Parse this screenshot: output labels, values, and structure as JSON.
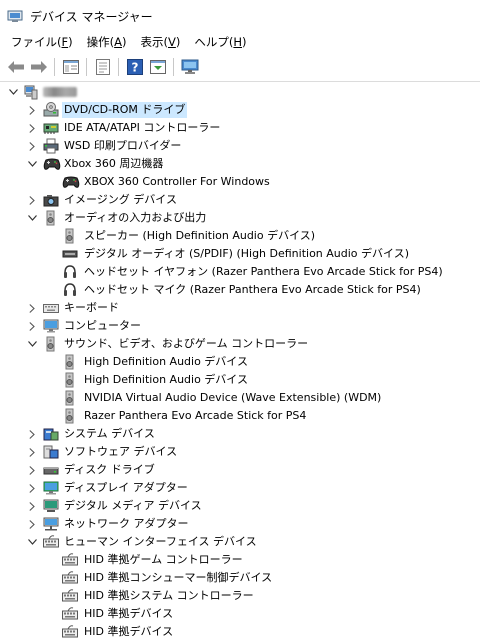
{
  "window": {
    "title": "デバイス マネージャー"
  },
  "menu": [
    {
      "label": "ファイル(",
      "key": "F",
      "tail": ")"
    },
    {
      "label": "操作(",
      "key": "A",
      "tail": ")"
    },
    {
      "label": "表示(",
      "key": "V",
      "tail": ")"
    },
    {
      "label": "ヘルプ(",
      "key": "H",
      "tail": ")"
    }
  ],
  "toolbar": {
    "icons": [
      "back-arrow-icon",
      "forward-arrow-icon",
      "properties-icon",
      "show-hide-console-tree-icon",
      "help-icon",
      "view-icon",
      "monitor-icon"
    ]
  },
  "tree": {
    "root": {
      "label": "",
      "expanded": true,
      "icon": "computer-icon"
    },
    "items": [
      {
        "label": "DVD/CD-ROM ドライブ",
        "level": 1,
        "state": "collapsed",
        "icon": "dvd-drive-icon",
        "selected": true
      },
      {
        "label": "IDE ATA/ATAPI コントローラー",
        "level": 1,
        "state": "collapsed",
        "icon": "ide-controller-icon"
      },
      {
        "label": "WSD 印刷プロバイダー",
        "level": 1,
        "state": "collapsed",
        "icon": "printer-icon"
      },
      {
        "label": "Xbox 360 周辺機器",
        "level": 1,
        "state": "expanded",
        "icon": "gamepad-icon"
      },
      {
        "label": "XBOX 360 Controller For Windows",
        "level": 2,
        "state": "leaf",
        "icon": "gamepad-icon"
      },
      {
        "label": "イメージング デバイス",
        "level": 1,
        "state": "collapsed",
        "icon": "camera-icon"
      },
      {
        "label": "オーディオの入力および出力",
        "level": 1,
        "state": "expanded",
        "icon": "speaker-icon"
      },
      {
        "label": "スピーカー (High Definition Audio デバイス)",
        "level": 2,
        "state": "leaf",
        "icon": "speaker-icon"
      },
      {
        "label": "デジタル オーディオ (S/PDIF) (High Definition Audio デバイス)",
        "level": 2,
        "state": "leaf",
        "icon": "spdif-icon"
      },
      {
        "label": "ヘッドセット イヤフォン (Razer Panthera Evo Arcade Stick for PS4)",
        "level": 2,
        "state": "leaf",
        "icon": "headset-icon"
      },
      {
        "label": "ヘッドセット マイク (Razer Panthera Evo Arcade Stick for PS4)",
        "level": 2,
        "state": "leaf",
        "icon": "headset-icon"
      },
      {
        "label": "キーボード",
        "level": 1,
        "state": "collapsed",
        "icon": "keyboard-icon"
      },
      {
        "label": "コンピューター",
        "level": 1,
        "state": "collapsed",
        "icon": "computer-icon"
      },
      {
        "label": "サウンド、ビデオ、およびゲーム コントローラー",
        "level": 1,
        "state": "expanded",
        "icon": "speaker-icon"
      },
      {
        "label": "High Definition Audio デバイス",
        "level": 2,
        "state": "leaf",
        "icon": "speaker-icon"
      },
      {
        "label": "High Definition Audio デバイス",
        "level": 2,
        "state": "leaf",
        "icon": "speaker-icon"
      },
      {
        "label": "NVIDIA Virtual Audio Device (Wave Extensible) (WDM)",
        "level": 2,
        "state": "leaf",
        "icon": "speaker-icon"
      },
      {
        "label": "Razer Panthera Evo Arcade Stick for PS4",
        "level": 2,
        "state": "leaf",
        "icon": "speaker-icon"
      },
      {
        "label": "システム デバイス",
        "level": 1,
        "state": "collapsed",
        "icon": "system-device-icon"
      },
      {
        "label": "ソフトウェア デバイス",
        "level": 1,
        "state": "collapsed",
        "icon": "software-device-icon"
      },
      {
        "label": "ディスク ドライブ",
        "level": 1,
        "state": "collapsed",
        "icon": "disk-drive-icon"
      },
      {
        "label": "ディスプレイ アダプター",
        "level": 1,
        "state": "collapsed",
        "icon": "display-adapter-icon"
      },
      {
        "label": "デジタル メディア デバイス",
        "level": 1,
        "state": "collapsed",
        "icon": "media-device-icon"
      },
      {
        "label": "ネットワーク アダプター",
        "level": 1,
        "state": "collapsed",
        "icon": "network-adapter-icon"
      },
      {
        "label": "ヒューマン インターフェイス デバイス",
        "level": 1,
        "state": "expanded",
        "icon": "hid-icon"
      },
      {
        "label": "HID 準拠ゲーム コントローラー",
        "level": 2,
        "state": "leaf",
        "icon": "hid-icon"
      },
      {
        "label": "HID 準拠コンシューマー制御デバイス",
        "level": 2,
        "state": "leaf",
        "icon": "hid-icon"
      },
      {
        "label": "HID 準拠システム コントローラー",
        "level": 2,
        "state": "leaf",
        "icon": "hid-icon"
      },
      {
        "label": "HID 準拠デバイス",
        "level": 2,
        "state": "leaf",
        "icon": "hid-icon"
      },
      {
        "label": "HID 準拠デバイス",
        "level": 2,
        "state": "leaf",
        "icon": "hid-icon"
      }
    ]
  }
}
